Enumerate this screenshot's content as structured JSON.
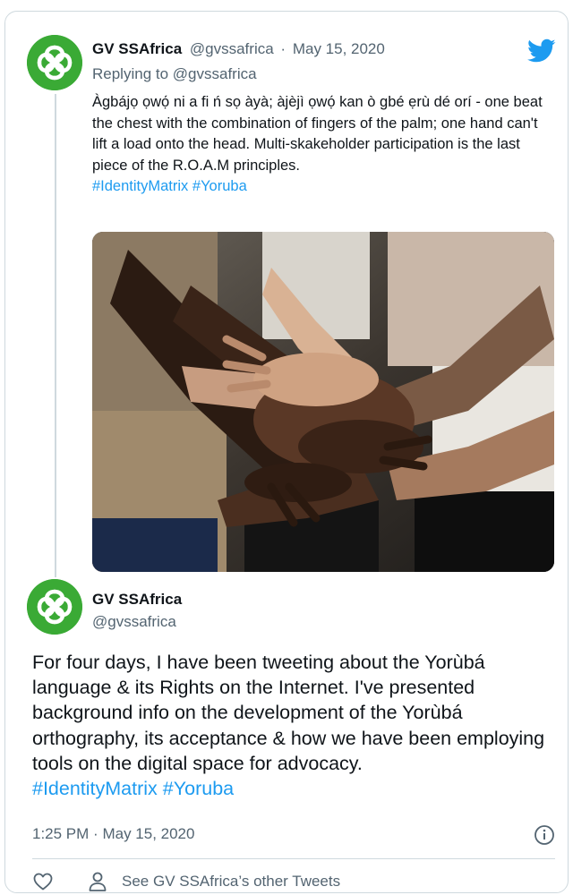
{
  "reply_tweet": {
    "display_name": "GV SSAfrica",
    "handle": "@gvssafrica",
    "separator": "·",
    "date": "May 15, 2020",
    "replying_prefix": "Replying to",
    "replying_to": "@gvssafrica",
    "text": "Àgbájọ ọwọ́ ni a fi ń sọ àyà; àjèjì ọwọ́ kan ò gbé ẹrù dé orí - one beat the chest with the combination of fingers of the palm; one hand can't lift a load onto the head. Multi-skakeholder participation is the last piece of the R.O.A.M principles.",
    "hashtags": [
      "#IdentityMatrix",
      "#Yoruba"
    ],
    "image_icon": "stacked-hands-photo"
  },
  "main_tweet": {
    "display_name": "GV SSAfrica",
    "handle": "@gvssafrica",
    "text": "For four days, I have been tweeting about the Yorùbá language & its Rights on the Internet. I've presented background info on the development of the Yorùbá orthography, its acceptance & how we have been employing tools on the digital space for advocacy.",
    "hashtags": [
      "#IdentityMatrix",
      "#Yoruba"
    ],
    "time": "1:25 PM",
    "separator": "·",
    "date": "May 15, 2020"
  },
  "footer": {
    "other_tweets_label": "See GV SSAfrica’s other Tweets",
    "icons": [
      "heart-icon",
      "person-icon",
      "info-icon"
    ]
  },
  "brand": {
    "logo_icon": "twitter-bird-icon",
    "accent": "#1d9bf0",
    "avatar_bg": "#3aaa35",
    "text_primary": "#0f1419",
    "text_secondary": "#536471",
    "border": "#cfd9de"
  }
}
